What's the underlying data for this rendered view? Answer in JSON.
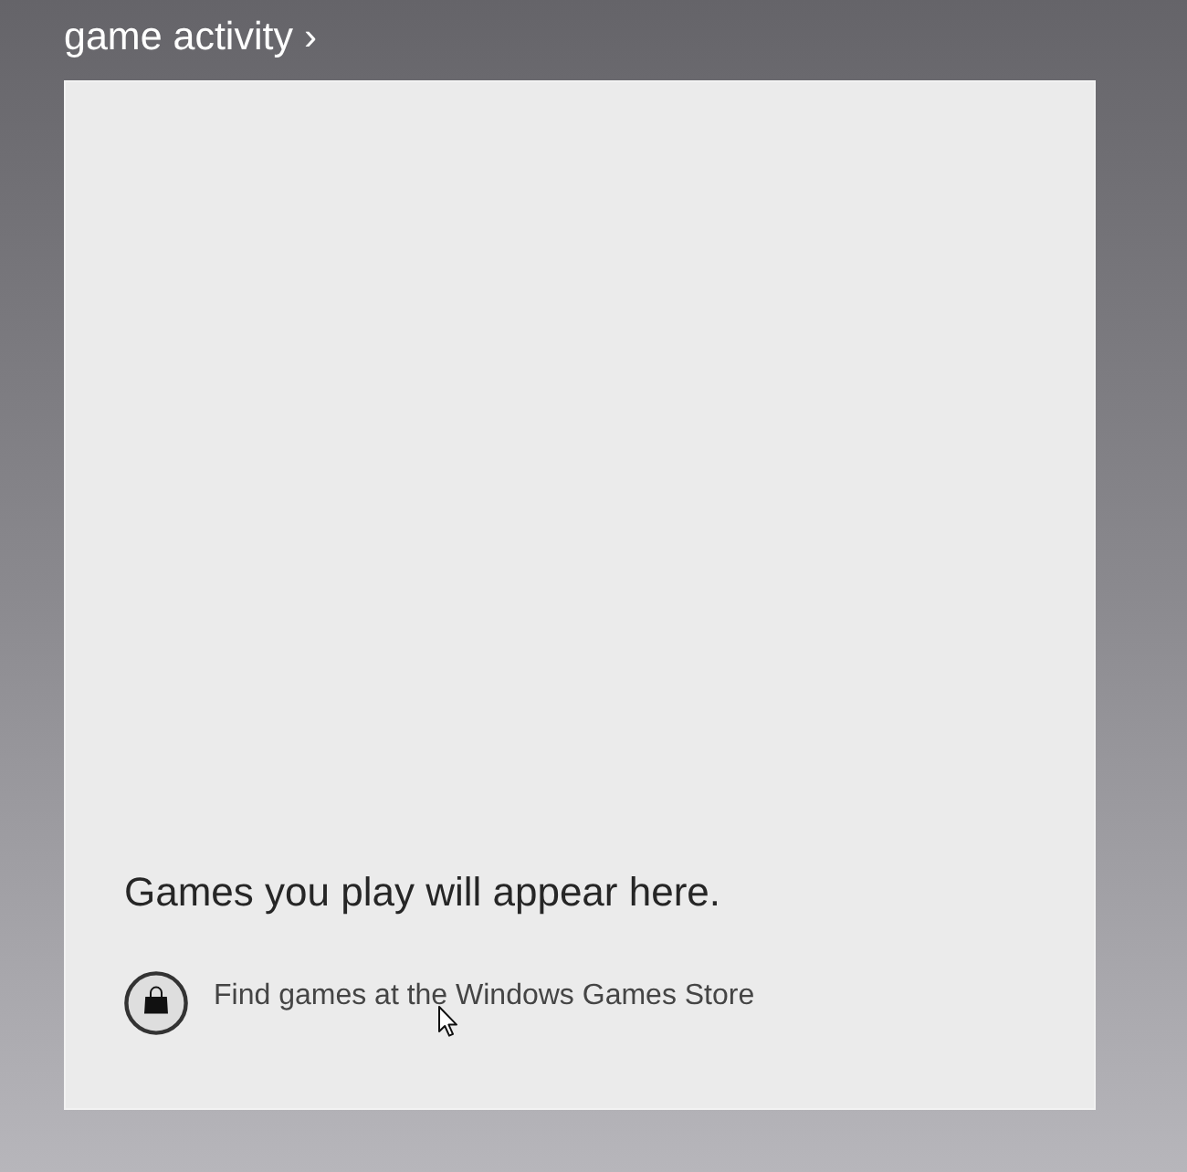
{
  "header": {
    "title": "game activity",
    "chevron": "›"
  },
  "panel": {
    "message": "Games you play will appear here.",
    "store_link": {
      "label": "Find games at the Windows Games Store"
    }
  }
}
